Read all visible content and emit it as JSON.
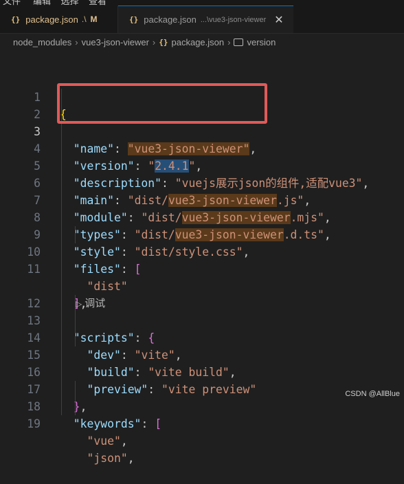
{
  "top_strip": {
    "menu_fragment": "文件     编辑    选择    查看"
  },
  "tabs": [
    {
      "icon": "{}",
      "name": "package.json",
      "description": ".\\",
      "badge": "M"
    },
    {
      "icon": "{}",
      "name": "package.json",
      "description": "...\\vue3-json-viewer",
      "close": "✕"
    }
  ],
  "breadcrumb": {
    "items": [
      "node_modules",
      "vue3-json-viewer",
      "package.json",
      "version"
    ],
    "file_icon": "{}",
    "separator": "›"
  },
  "editor": {
    "codelens": {
      "icon": "play-icon",
      "label": "调试"
    },
    "lines": [
      {
        "n": "1"
      },
      {
        "n": "2",
        "key": "\"name\"",
        "val": "\"vue3-json-viewer\""
      },
      {
        "n": "3",
        "key": "\"version\"",
        "val": "2.4.1"
      },
      {
        "n": "4",
        "key": "\"description\"",
        "val": "\"vuejs展示json的组件,适配vue3\""
      },
      {
        "n": "5",
        "key": "\"main\"",
        "val_prefix": "\"dist/",
        "val_hl": "vue3-json-viewer",
        "val_suffix": ".js\""
      },
      {
        "n": "6",
        "key": "\"module\"",
        "val_prefix": "\"dist/",
        "val_hl": "vue3-json-viewer",
        "val_suffix": ".mjs\""
      },
      {
        "n": "7",
        "key": "\"types\"",
        "val_prefix": "\"dist/",
        "val_hl": "vue3-json-viewer",
        "val_suffix": ".d.ts\""
      },
      {
        "n": "8",
        "key": "\"style\"",
        "val": "\"dist/style.css\""
      },
      {
        "n": "9",
        "key": "\"files\""
      },
      {
        "n": "10",
        "val": "\"dist\""
      },
      {
        "n": "11"
      },
      {
        "n": "12",
        "key": "\"scripts\""
      },
      {
        "n": "13",
        "key": "\"dev\"",
        "val": "\"vite\""
      },
      {
        "n": "14",
        "key": "\"build\"",
        "val": "\"vite build\""
      },
      {
        "n": "15",
        "key": "\"preview\"",
        "val": "\"vite preview\""
      },
      {
        "n": "16"
      },
      {
        "n": "17",
        "key": "\"keywords\""
      },
      {
        "n": "18",
        "val": "\"vue\""
      },
      {
        "n": "19",
        "val": "\"json\""
      }
    ]
  },
  "watermark": "CSDN @AllBlue",
  "colors": {
    "background": "#1f1f1f",
    "json_key": "#9cdcfe",
    "json_string": "#ce9178",
    "bracket_gold": "#ffd700",
    "bracket_purple": "#da70d6",
    "annotation_red": "#e05a5a"
  }
}
